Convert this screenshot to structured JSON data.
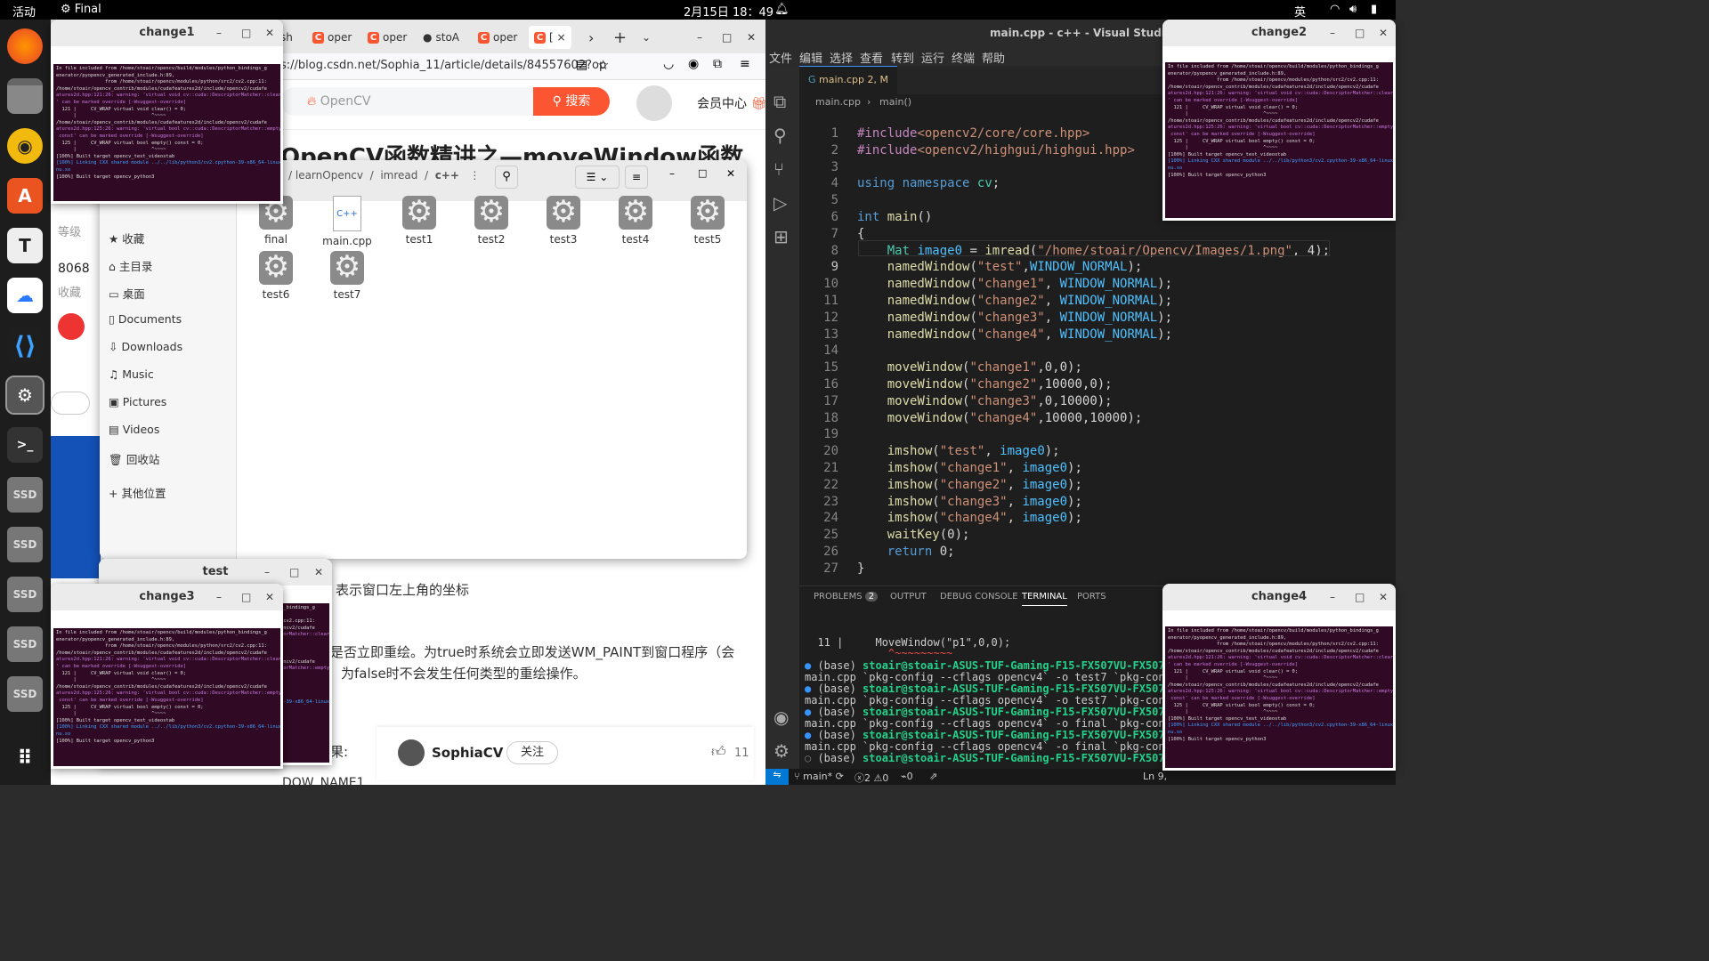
{
  "topbar": {
    "activities": "活动",
    "app_name": "Final",
    "datetime": "2月15日 18：49",
    "input_method": "英"
  },
  "dock": {
    "ssd_label": "SSD"
  },
  "browser": {
    "tabs": [
      "sh",
      "oper",
      "oper",
      "stoA",
      "oper",
      "[ ×"
    ],
    "url": "s://blog.csdn.net/Sophia_11/article/details/84557602?op",
    "search_placeholder": "OpenCV",
    "search_button": "搜索",
    "member": "会员中心",
    "article_title": "OpenCV函数精讲之—moveWindow函数",
    "side": {
      "level": "等级",
      "count": "8068",
      "fav": "收藏"
    },
    "body_1": "表示窗口左上角的坐标",
    "body_2": "是否立即重绘。为true时系统会立即发送WM_PAINT到窗口程序（会",
    "body_3": "为false时不会发生任何类型的重绘操作。",
    "body_4": "果:",
    "body_5": "DOW_NAME1",
    "author": "SophiaCV",
    "follow": "关注",
    "likes": "11"
  },
  "files": {
    "crumbs": [
      "learnOpencv",
      "imread",
      "c++"
    ],
    "sidebar": [
      "收藏",
      "主目录",
      "桌面",
      "Documents",
      "Downloads",
      "Music",
      "Pictures",
      "Videos",
      "回收站",
      "其他位置"
    ],
    "items": [
      "final",
      "main.cpp",
      "test1",
      "test2",
      "test3",
      "test4",
      "test5",
      "test6",
      "test7"
    ]
  },
  "windows": {
    "change1": "change1",
    "change2": "change2",
    "change3": "change3",
    "change4": "change4",
    "test": "test"
  },
  "term_lines": [
    "In file included from /home/stoair/opencv/build/modules/python_bindings_g",
    "enerator/pyopencv_generated_include.h:89,",
    "                 from /home/stoair/opencv/modules/python/src2/cv2.cpp:11:",
    "/home/stoair/opencv_contrib/modules/cudafeatures2d/include/opencv2/cudafe",
    "atures2d.hpp:121:26: warning: 'virtual void cv::cuda::DescriptorMatcher::clear()",
    "' can be marked override [-Wsuggest-override]",
    "  121 |     CV_WRAP virtual void clear() = 0;",
    "      |                          ^~~~~",
    "/home/stoair/opencv_contrib/modules/cudafeatures2d/include/opencv2/cudafe",
    "atures2d.hpp:125:26: warning: 'virtual bool cv::cuda::DescriptorMatcher::empty()",
    " const' can be marked override [-Wsuggest-override]",
    "  125 |     CV_WRAP virtual bool empty() const = 0;",
    "      |                          ^~~~~",
    "[100%] Built target opencv_test_videostab",
    "[100%] Linking CXX shared module ../../lib/python3/cv2.cpython-39-x86_64-linux-g",
    "nu.so",
    "[100%] Built target opencv_python3"
  ],
  "vscode": {
    "title": "main.cpp - c++ - Visual Studio Cod",
    "menu": [
      "文件",
      "编辑",
      "选择",
      "查看",
      "转到",
      "运行",
      "终端",
      "帮助"
    ],
    "tab": "main.cpp 2, M",
    "crumb_file": "main.cpp",
    "crumb_fn": "main()",
    "code": [
      "#include<opencv2/core/core.hpp>",
      "#include<opencv2/highgui/highgui.hpp>",
      "",
      "using namespace cv;",
      "",
      "int main()",
      "{",
      "    Mat image0 = imread(\"/home/stoair/Opencv/Images/1.png\", 4);",
      "    namedWindow(\"test\",WINDOW_NORMAL);",
      "    namedWindow(\"change1\", WINDOW_NORMAL);",
      "    namedWindow(\"change2\", WINDOW_NORMAL);",
      "    namedWindow(\"change3\", WINDOW_NORMAL);",
      "    namedWindow(\"change4\", WINDOW_NORMAL);",
      "",
      "    moveWindow(\"change1\",0,0);",
      "    moveWindow(\"change2\",10000,0);",
      "    moveWindow(\"change3\",0,10000);",
      "    moveWindow(\"change4\",10000,10000);",
      "",
      "    imshow(\"test\", image0);",
      "    imshow(\"change1\", image0);",
      "    imshow(\"change2\", image0);",
      "    imshow(\"change3\", image0);",
      "    imshow(\"change4\", image0);",
      "    waitKey(0);",
      "    return 0;",
      "}"
    ],
    "panel_tabs": [
      "PROBLEMS",
      "OUTPUT",
      "DEBUG CONSOLE",
      "TERMINAL",
      "PORTS"
    ],
    "problems_count": "2",
    "term_first": "  11 |     MoveWindow(\"p1\",0,0);",
    "term_first_err": "             ^~~~~~~~~~",
    "prompt": "stoair@stoair-ASUS-TUF-Gaming-F15-FX507VU-FX507VU:~/O",
    "cmds": [
      "main.cpp `pkg-config --cflags opencv4` -o test7 `pkg-config",
      "main.cpp `pkg-config --cflags opencv4` -o test7 `pkg-config",
      "main.cpp `pkg-config --cflags opencv4` -o final `pkg-config",
      "main.cpp `pkg-config --cflags opencv4` -o final `pkg-config"
    ],
    "status": {
      "branch": "main*",
      "errors": "2",
      "warnings": "0",
      "ports": "0",
      "ln": "Ln 9,"
    }
  },
  "colors": {
    "csdn": "#fc5531",
    "vscode_status": "#181818",
    "term_bg": "#300a24"
  }
}
